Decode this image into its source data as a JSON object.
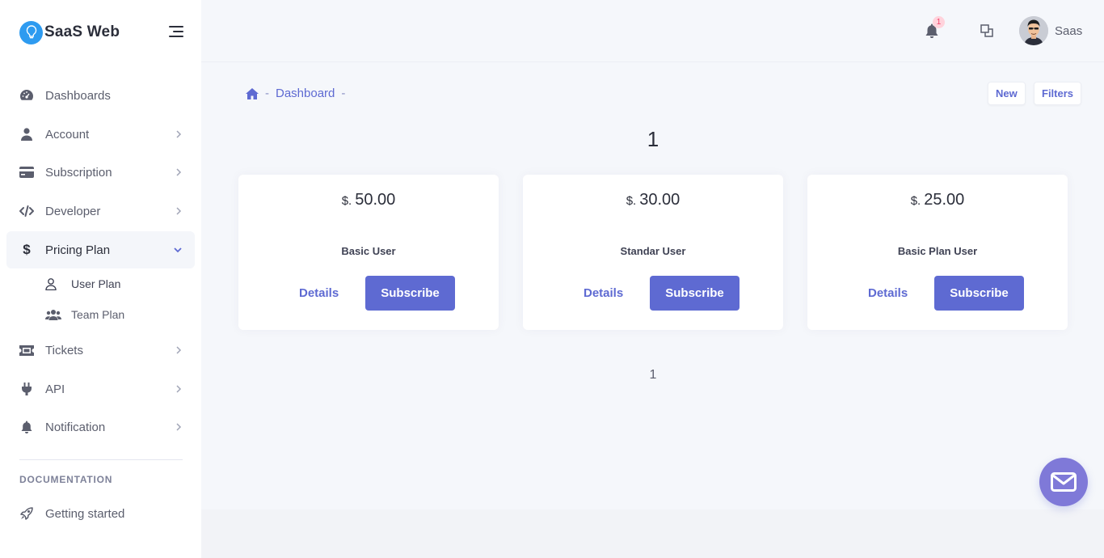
{
  "brand": {
    "name": "SaaS Web"
  },
  "sidebar": {
    "items": [
      {
        "label": "Dashboards",
        "icon": "dashboard-icon"
      },
      {
        "label": "Account",
        "icon": "user-icon"
      },
      {
        "label": "Subscription",
        "icon": "credit-card-icon"
      },
      {
        "label": "Developer",
        "icon": "code-icon"
      },
      {
        "label": "Pricing Plan",
        "icon": "dollar-icon",
        "active": true
      },
      {
        "label": "Tickets",
        "icon": "ticket-icon"
      },
      {
        "label": "API",
        "icon": "plug-icon"
      },
      {
        "label": "Notification",
        "icon": "bell-icon"
      }
    ],
    "sub_items": [
      {
        "label": "User Plan",
        "icon": "user-outline-icon"
      },
      {
        "label": "Team Plan",
        "icon": "users-icon"
      }
    ],
    "section_title": "DOCUMENTATION",
    "doc_items": [
      {
        "label": "Getting started",
        "icon": "rocket-icon"
      }
    ]
  },
  "header": {
    "notification_count": "1",
    "username": "Saas"
  },
  "breadcrumb": {
    "items": [
      "Dashboard"
    ]
  },
  "toolbar": {
    "new_label": "New",
    "filters_label": "Filters"
  },
  "page": {
    "title": "1",
    "pagination": "1"
  },
  "plans": [
    {
      "currency": "$.",
      "price": "50.00",
      "name": "Basic User",
      "details_label": "Details",
      "subscribe_label": "Subscribe"
    },
    {
      "currency": "$.",
      "price": "30.00",
      "name": "Standar User",
      "details_label": "Details",
      "subscribe_label": "Subscribe"
    },
    {
      "currency": "$.",
      "price": "25.00",
      "name": "Basic Plan User",
      "details_label": "Details",
      "subscribe_label": "Subscribe"
    }
  ],
  "colors": {
    "primary": "#5e6ad2",
    "fab": "#7f79d8",
    "brand_logo": "#2e9bf0"
  }
}
